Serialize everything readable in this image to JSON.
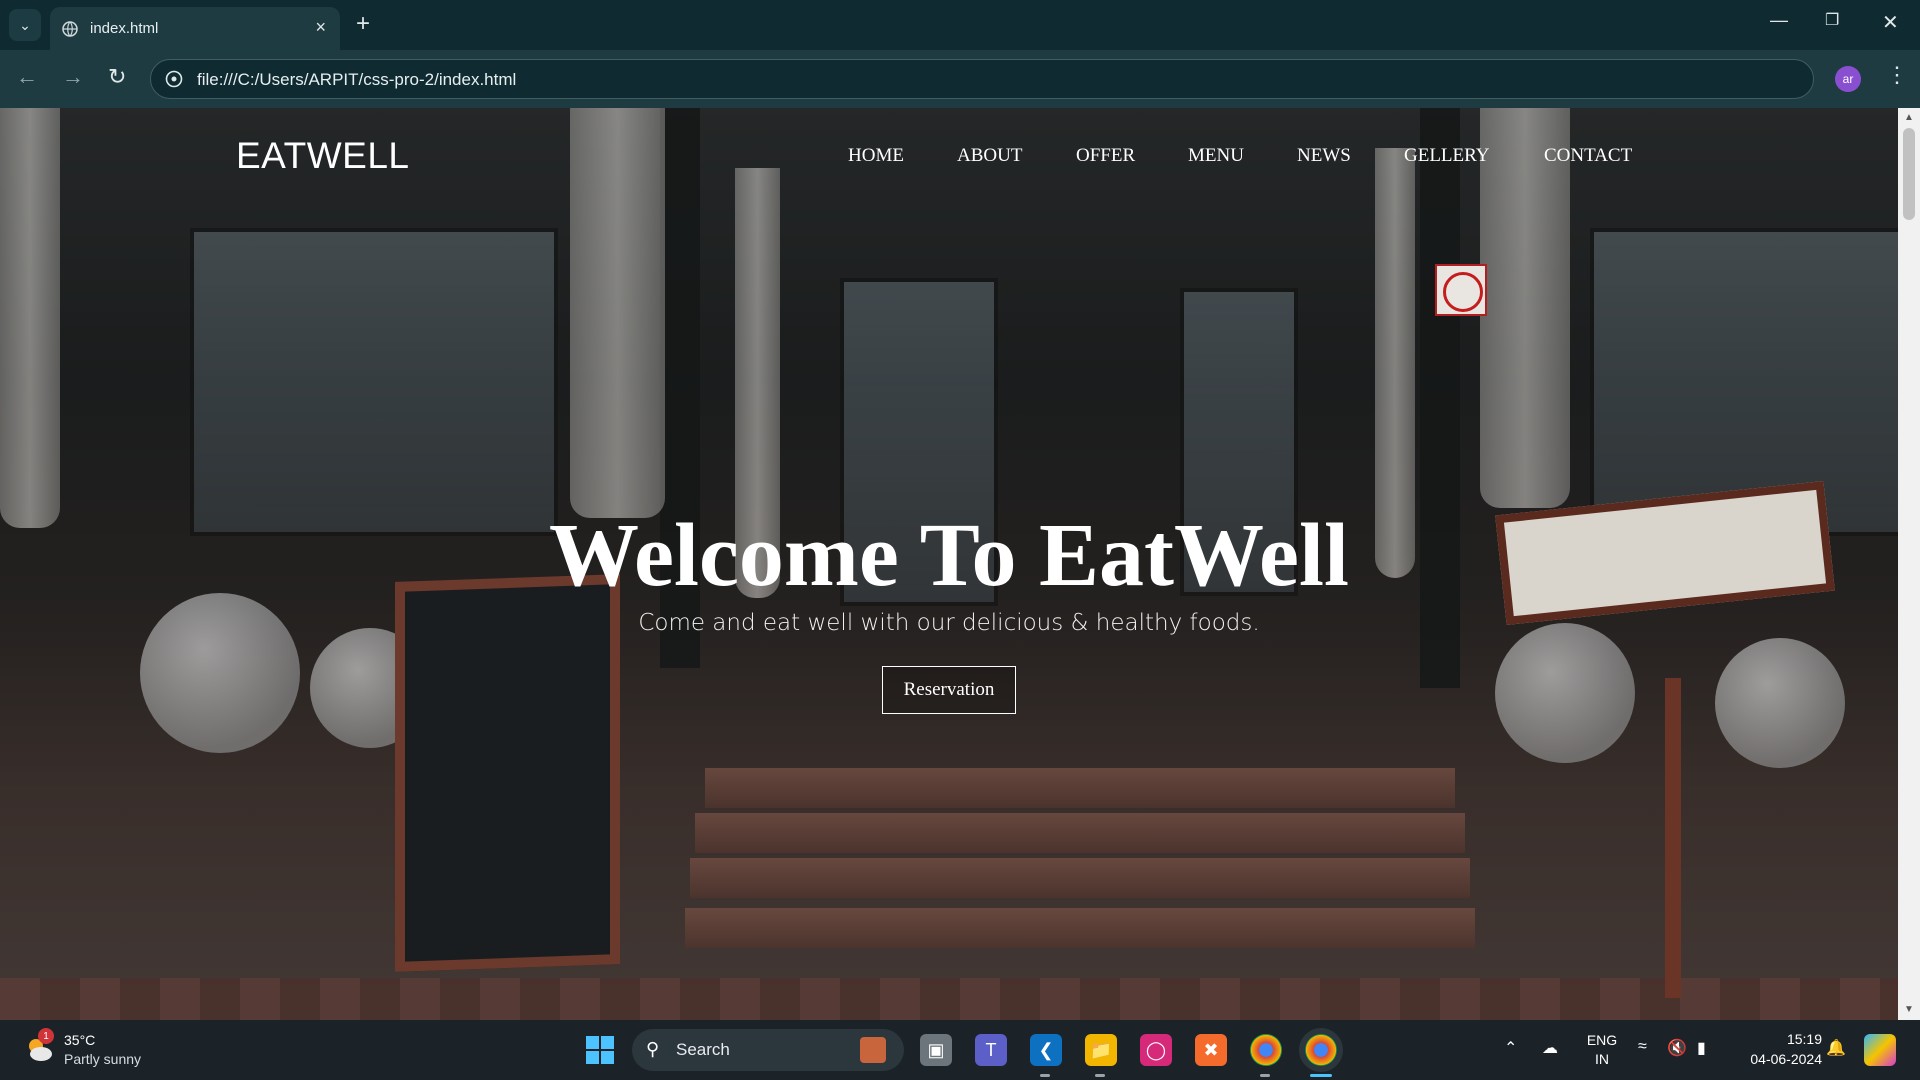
{
  "browser": {
    "tab_title": "index.html",
    "url": "file:///C:/Users/ARPIT/css-pro-2/index.html",
    "profile_initials": "ar"
  },
  "site": {
    "logo": "EATWELL",
    "nav": [
      "HOME",
      "ABOUT",
      "OFFER",
      "MENU",
      "NEWS",
      "GELLERY",
      "CONTACT"
    ],
    "hero_title": "Welcome To EatWell",
    "hero_subtitle": "Come and eat well with our delicious & healthy foods.",
    "cta_label": "Reservation"
  },
  "taskbar": {
    "weather_temp": "35°C",
    "weather_desc": "Partly sunny",
    "weather_badge": "1",
    "search_label": "Search",
    "lang_top": "ENG",
    "lang_bottom": "IN",
    "time": "15:19",
    "date": "04-06-2024"
  }
}
